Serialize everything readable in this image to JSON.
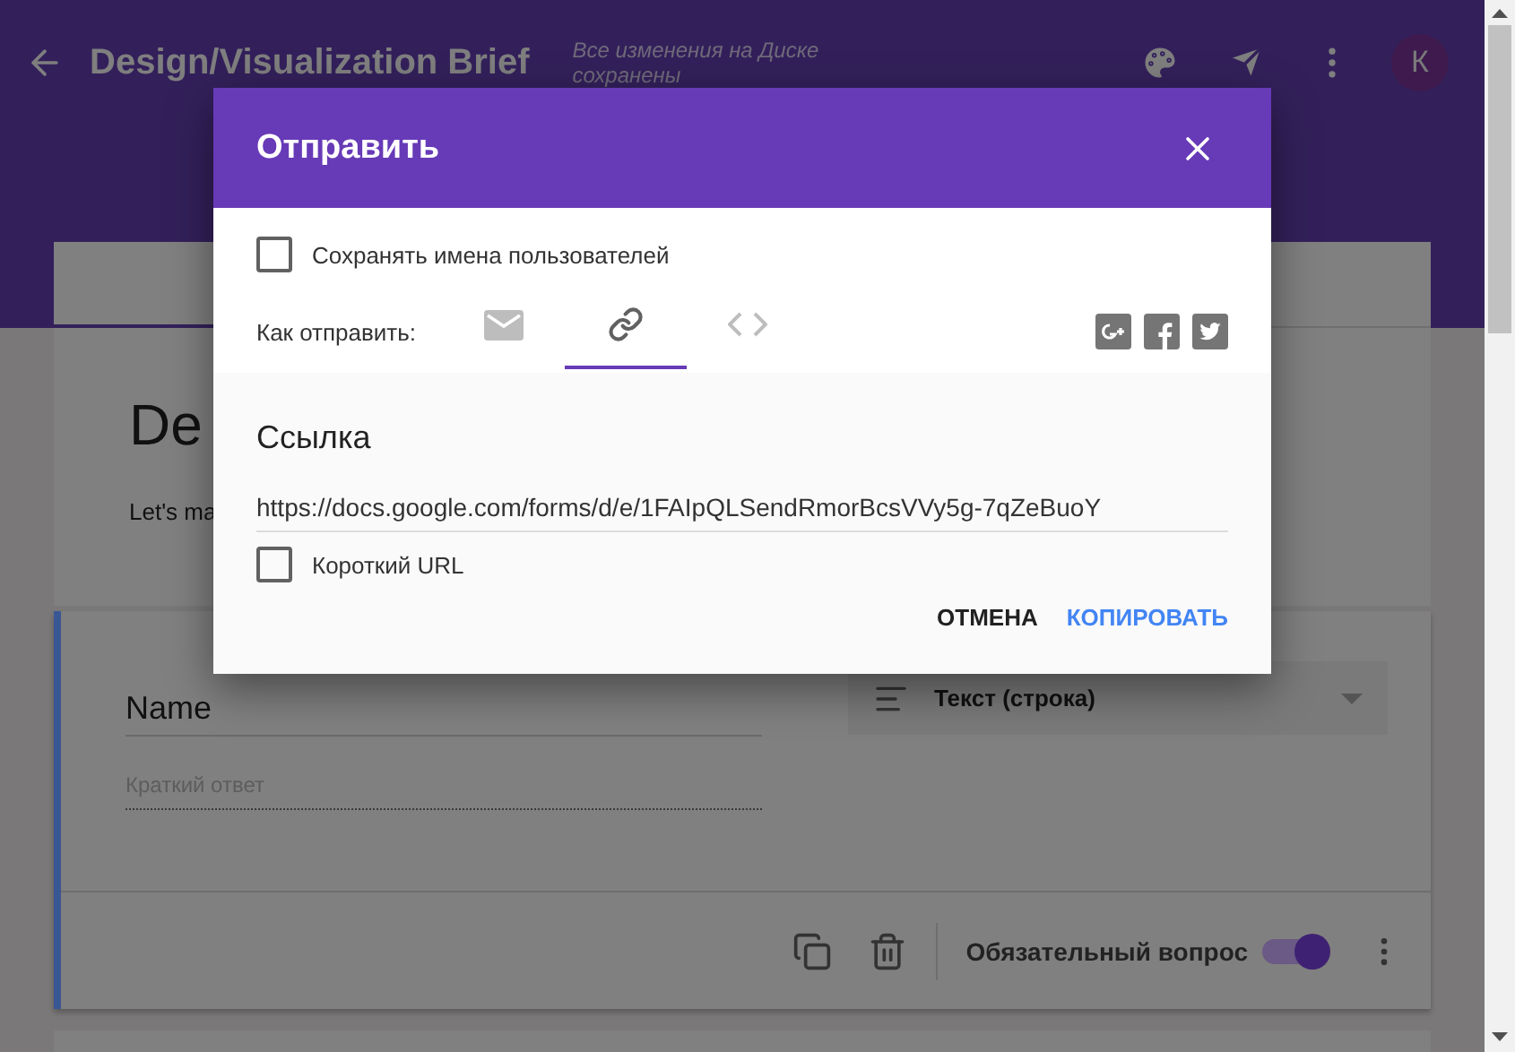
{
  "header": {
    "title": "Design/Visualization Brief",
    "save_status": "Все изменения на Диске сохранены",
    "avatar": "К"
  },
  "form_title": {
    "title": "De",
    "description": "Let's ma"
  },
  "question": {
    "title": "Name",
    "answer_placeholder": "Краткий ответ",
    "type": "Текст (строка)",
    "required_label": "Обязательный вопрос",
    "required": true
  },
  "dialog": {
    "title": "Отправить",
    "collect_names": {
      "label": "Сохранять имена пользователей",
      "checked": false
    },
    "send_via_label": "Как отправить:",
    "tabs": [
      {
        "kind": "email",
        "selected": false
      },
      {
        "kind": "link",
        "selected": true
      },
      {
        "kind": "embed",
        "selected": false
      }
    ],
    "link": {
      "heading": "Ссылка",
      "url": "https://docs.google.com/forms/d/e/1FAIpQLSendRmorBcsVVy5g-7qZeBuoY",
      "short_url": {
        "label": "Короткий URL",
        "checked": false
      }
    },
    "buttons": [
      {
        "kind": "secondary",
        "label": "ОТМЕНА"
      },
      {
        "kind": "primary",
        "label": "КОПИРОВАТЬ"
      }
    ]
  }
}
